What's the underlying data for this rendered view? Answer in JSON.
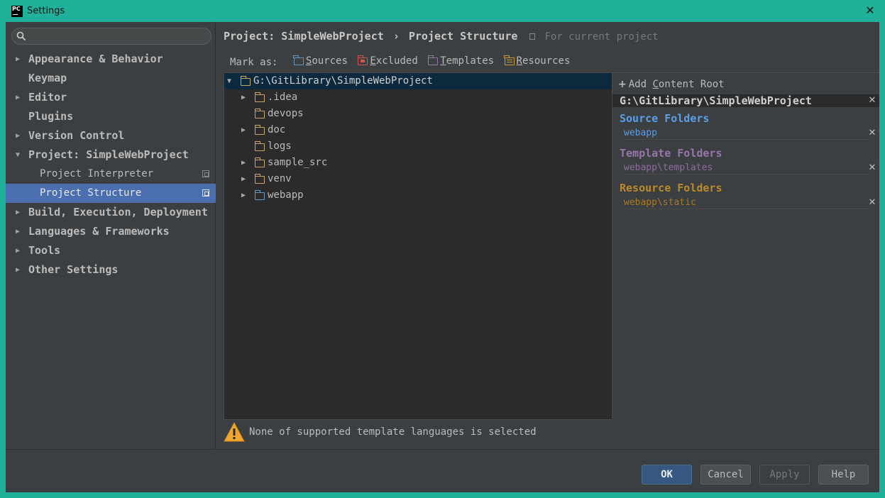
{
  "window": {
    "title": "Settings",
    "app_icon_text": "PC"
  },
  "search": {
    "placeholder": ""
  },
  "sidebar": {
    "items": [
      {
        "label": "Appearance & Behavior",
        "arrow": "▶"
      },
      {
        "label": "Keymap",
        "arrow": ""
      },
      {
        "label": "Editor",
        "arrow": "▶"
      },
      {
        "label": "Plugins",
        "arrow": ""
      },
      {
        "label": "Version Control",
        "arrow": "▶"
      },
      {
        "label": "Project: SimpleWebProject",
        "arrow": "▼"
      },
      {
        "label": "Project Interpreter",
        "arrow": ""
      },
      {
        "label": "Project Structure",
        "arrow": ""
      },
      {
        "label": "Build, Execution, Deployment",
        "arrow": "▶"
      },
      {
        "label": "Languages & Frameworks",
        "arrow": "▶"
      },
      {
        "label": "Tools",
        "arrow": "▶"
      },
      {
        "label": "Other Settings",
        "arrow": "▶"
      }
    ]
  },
  "breadcrumb": {
    "project": "Project: SimpleWebProject",
    "separator": "›",
    "page": "Project Structure",
    "note": "For current project"
  },
  "mark_as": {
    "label": "Mark as:",
    "sources_first": "S",
    "sources_rest": "ources",
    "excluded_first": "E",
    "excluded_rest": "xcluded",
    "templates_first": "T",
    "templates_rest": "emplates",
    "resources_first": "R",
    "resources_rest": "esources"
  },
  "tree": {
    "root": "G:\\GitLibrary\\SimpleWebProject",
    "children": [
      {
        "name": ".idea",
        "expandable": true
      },
      {
        "name": "devops",
        "expandable": false
      },
      {
        "name": "doc",
        "expandable": true
      },
      {
        "name": "logs",
        "expandable": false
      },
      {
        "name": "sample_src",
        "expandable": true
      },
      {
        "name": "venv",
        "expandable": true
      },
      {
        "name": "webapp",
        "expandable": true
      }
    ],
    "expand_arrow": "▶",
    "collapse_arrow": "▼"
  },
  "warning": {
    "text": "None of supported template languages is selected"
  },
  "content_roots": {
    "add_plus": "+",
    "add_label_pre": "Add ",
    "add_label_u": "C",
    "add_label_post": "ontent Root",
    "root_path": "G:\\GitLibrary\\SimpleWebProject",
    "remove_glyph": "✕",
    "source_title": "Source Folders",
    "source_item": "webapp",
    "template_title": "Template Folders",
    "template_item": "webapp\\templates",
    "resource_title": "Resource Folders",
    "resource_item": "webapp\\static"
  },
  "buttons": {
    "ok": "OK",
    "cancel": "Cancel",
    "apply": "Apply",
    "help": "Help"
  },
  "colors": {
    "titlebar": "#1fb199",
    "selection": "#4b6eaf",
    "sources": "#6897bb",
    "excluded": "#d9534f",
    "templates": "#9876aa",
    "resources": "#cc9933"
  }
}
